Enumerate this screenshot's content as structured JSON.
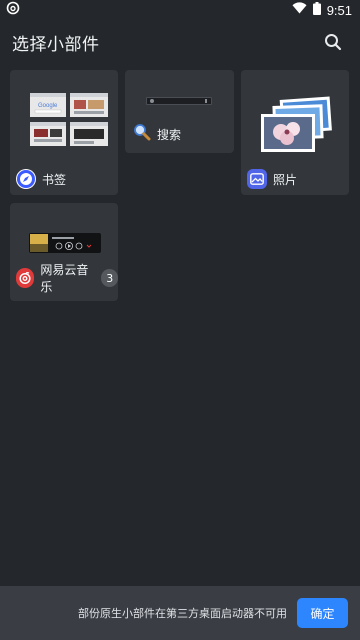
{
  "status_bar": {
    "time": "9:51"
  },
  "app_bar": {
    "title": "选择小部件"
  },
  "widgets": [
    {
      "label": "书签",
      "icon": "compass-icon",
      "accent": "#3b5bff"
    },
    {
      "label": "搜索",
      "icon": "magnifier-icon"
    },
    {
      "label": "照片",
      "icon": "photo-icon",
      "accent": "#5165e8"
    },
    {
      "label": "网易云音乐",
      "icon": "netease-music-icon",
      "accent": "#e03a3a",
      "badge": "3"
    }
  ],
  "footer": {
    "note": "部份原生小部件在第三方桌面启动器不可用",
    "confirm_label": "确定"
  },
  "colors": {
    "background": "#24272b",
    "card": "#33373c",
    "footer": "#3a3e44",
    "primary_button": "#2e86ff"
  }
}
